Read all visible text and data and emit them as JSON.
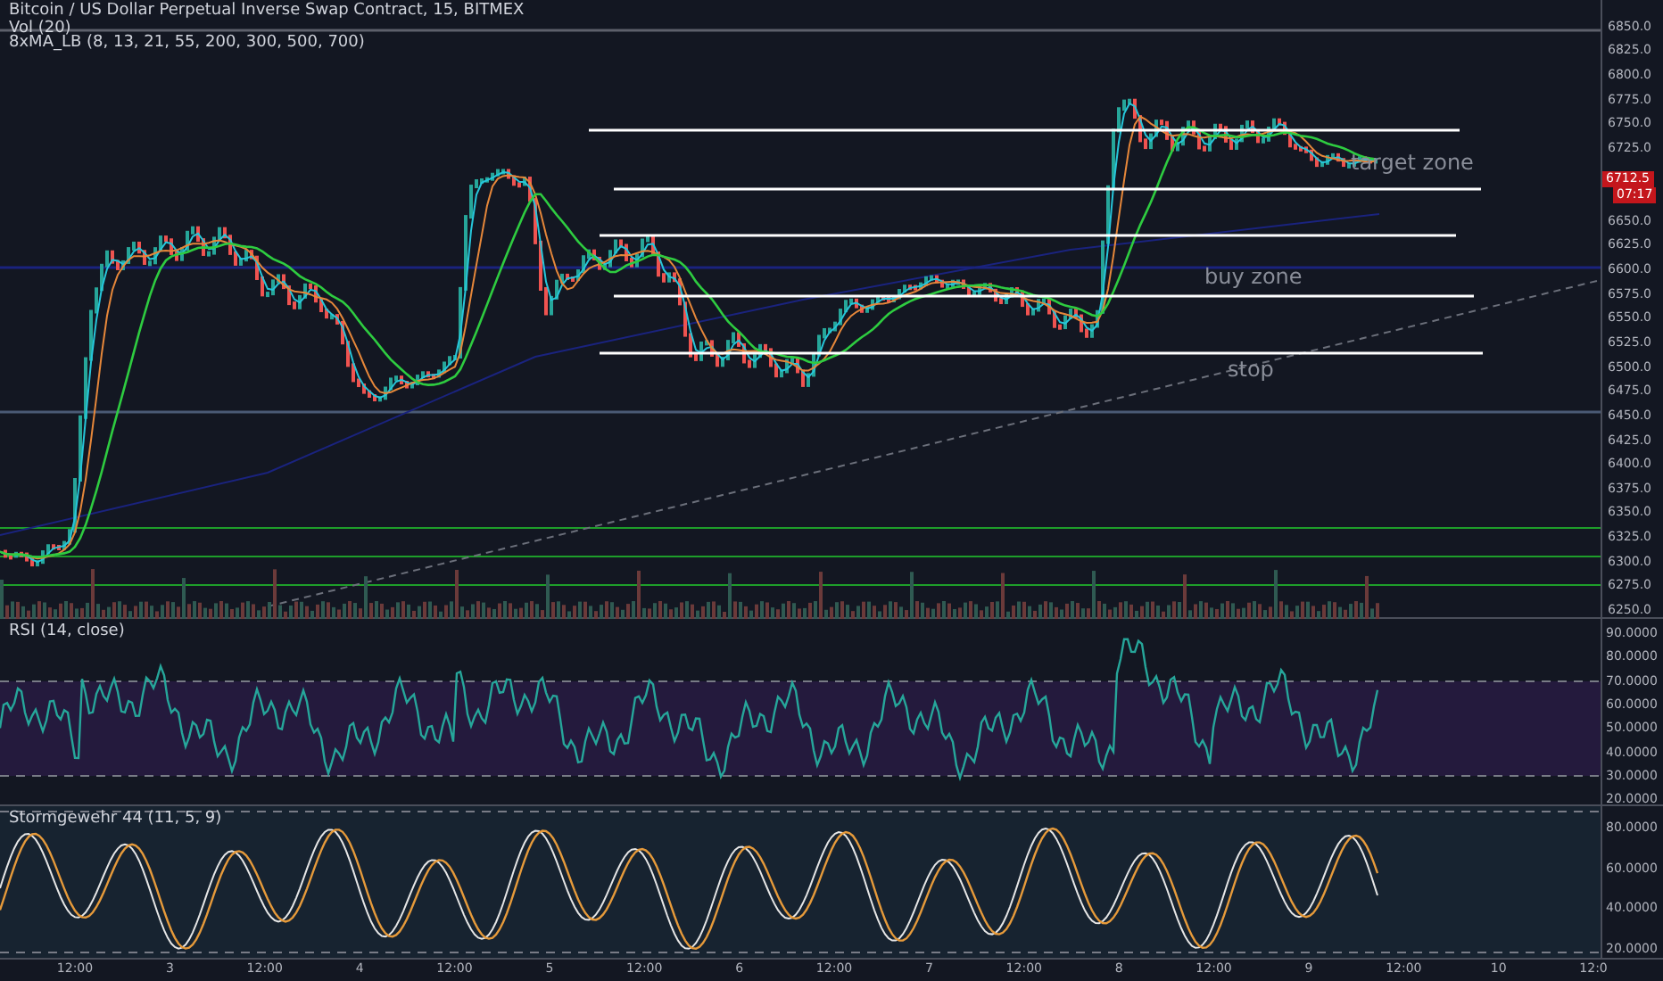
{
  "main_pane": {
    "title": "Bitcoin / US Dollar Perpetual Inverse Swap Contract, 15, BITMEX",
    "volume_label": "Vol (20)",
    "indicator_label": "8xMA_LB (8, 13, 21, 55, 200, 300, 500, 700)",
    "annotations": [
      "target zone",
      "buy zone",
      "stop"
    ],
    "price_ticks_upper": [
      "6850.0",
      "6825.0",
      "6800.0",
      "6775.0",
      "6750.0",
      "6725.0"
    ],
    "price_ticks_lower": [
      "6650.0",
      "6625.0",
      "6600.0",
      "6575.0",
      "6550.0",
      "6525.0",
      "6500.0",
      "6475.0",
      "6450.0",
      "6425.0",
      "6400.0",
      "6375.0",
      "6350.0",
      "6325.0",
      "6300.0",
      "6275.0",
      "6250.0"
    ],
    "price_tag": {
      "price": "6712.5",
      "countdown": "07:17"
    }
  },
  "rsi_pane": {
    "title": "RSI (14, close)",
    "ticks": [
      "90.0000",
      "80.0000",
      "70.0000",
      "60.0000",
      "50.0000",
      "40.0000",
      "30.0000",
      "20.0000"
    ]
  },
  "oscillator_pane": {
    "title": "Stormgewehr 44 (11, 5, 9)",
    "ticks": [
      "80.0000",
      "60.0000",
      "40.0000",
      "20.0000"
    ]
  },
  "time_axis": [
    "12:00",
    "3",
    "12:00",
    "4",
    "12:00",
    "5",
    "12:00",
    "6",
    "12:00",
    "7",
    "12:00",
    "8",
    "12:00",
    "9",
    "12:00",
    "10",
    "12:0"
  ]
}
